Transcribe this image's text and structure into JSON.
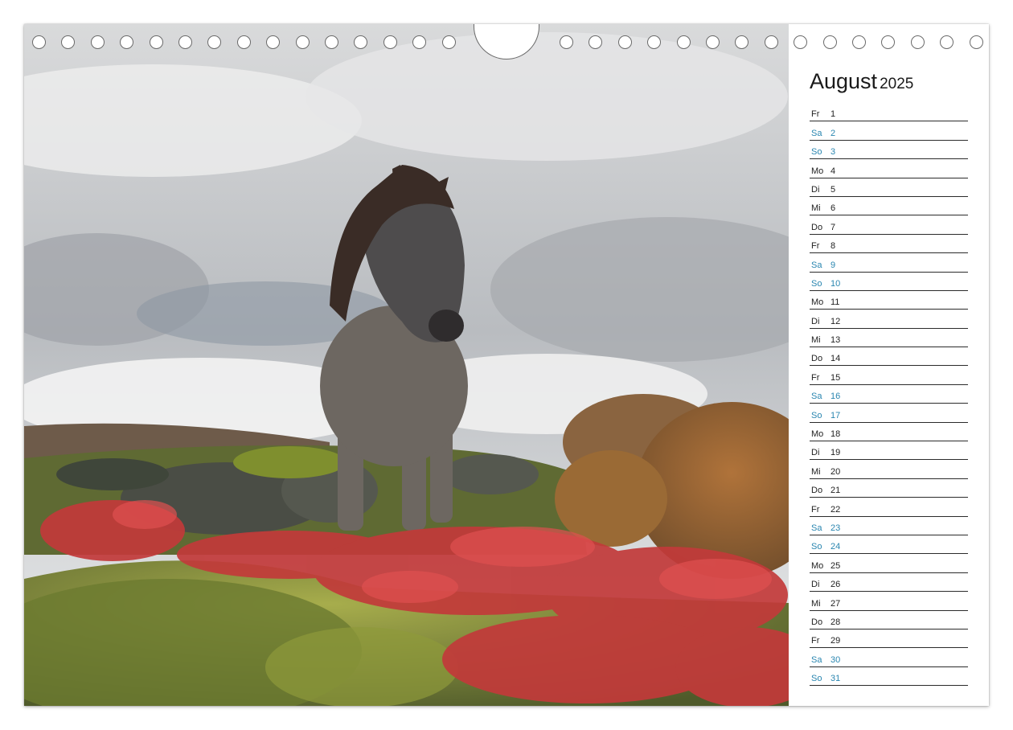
{
  "calendar": {
    "month": "August",
    "year": "2025",
    "weekend_color": "#2a86b0",
    "days": [
      {
        "wd": "Fr",
        "num": "1",
        "weekend": false
      },
      {
        "wd": "Sa",
        "num": "2",
        "weekend": true
      },
      {
        "wd": "So",
        "num": "3",
        "weekend": true
      },
      {
        "wd": "Mo",
        "num": "4",
        "weekend": false
      },
      {
        "wd": "Di",
        "num": "5",
        "weekend": false
      },
      {
        "wd": "Mi",
        "num": "6",
        "weekend": false
      },
      {
        "wd": "Do",
        "num": "7",
        "weekend": false
      },
      {
        "wd": "Fr",
        "num": "8",
        "weekend": false
      },
      {
        "wd": "Sa",
        "num": "9",
        "weekend": true
      },
      {
        "wd": "So",
        "num": "10",
        "weekend": true
      },
      {
        "wd": "Mo",
        "num": "11",
        "weekend": false
      },
      {
        "wd": "Di",
        "num": "12",
        "weekend": false
      },
      {
        "wd": "Mi",
        "num": "13",
        "weekend": false
      },
      {
        "wd": "Do",
        "num": "14",
        "weekend": false
      },
      {
        "wd": "Fr",
        "num": "15",
        "weekend": false
      },
      {
        "wd": "Sa",
        "num": "16",
        "weekend": true
      },
      {
        "wd": "So",
        "num": "17",
        "weekend": true
      },
      {
        "wd": "Mo",
        "num": "18",
        "weekend": false
      },
      {
        "wd": "Di",
        "num": "19",
        "weekend": false
      },
      {
        "wd": "Mi",
        "num": "20",
        "weekend": false
      },
      {
        "wd": "Do",
        "num": "21",
        "weekend": false
      },
      {
        "wd": "Fr",
        "num": "22",
        "weekend": false
      },
      {
        "wd": "Sa",
        "num": "23",
        "weekend": true
      },
      {
        "wd": "So",
        "num": "24",
        "weekend": true
      },
      {
        "wd": "Mo",
        "num": "25",
        "weekend": false
      },
      {
        "wd": "Di",
        "num": "26",
        "weekend": false
      },
      {
        "wd": "Mi",
        "num": "27",
        "weekend": false
      },
      {
        "wd": "Do",
        "num": "28",
        "weekend": false
      },
      {
        "wd": "Fr",
        "num": "29",
        "weekend": false
      },
      {
        "wd": "Sa",
        "num": "30",
        "weekend": true
      },
      {
        "wd": "So",
        "num": "31",
        "weekend": true
      }
    ]
  }
}
